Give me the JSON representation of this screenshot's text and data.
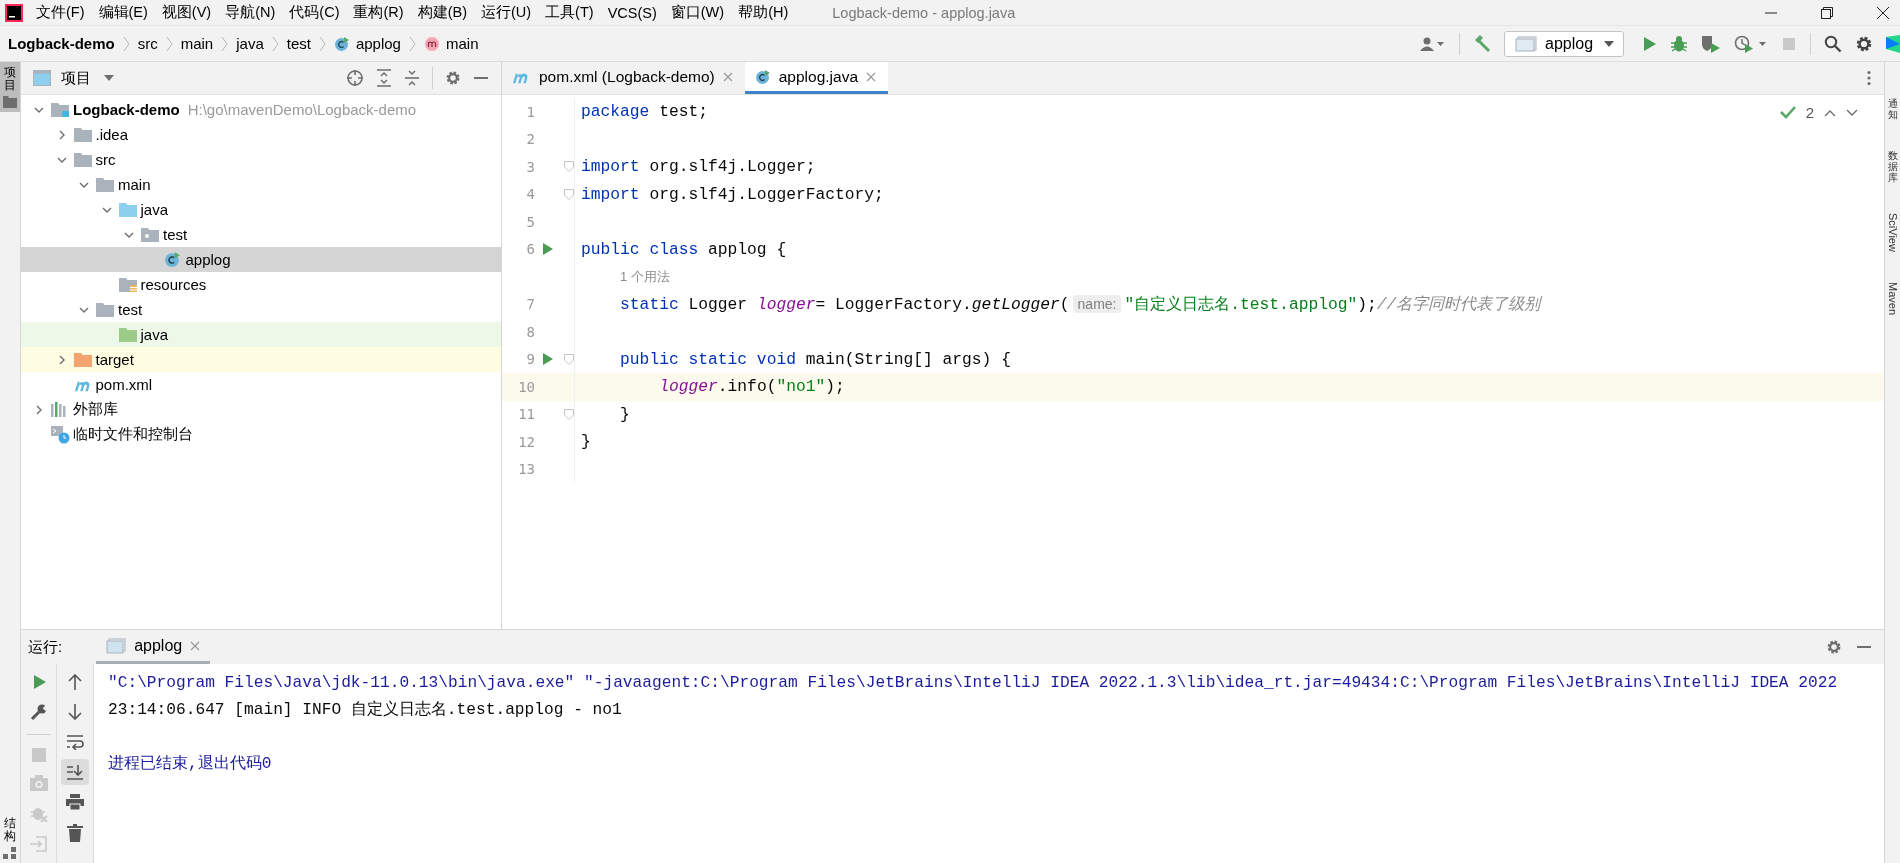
{
  "menu_bar": {
    "items": [
      "文件(F)",
      "编辑(E)",
      "视图(V)",
      "导航(N)",
      "代码(C)",
      "重构(R)",
      "构建(B)",
      "运行(U)",
      "工具(T)",
      "VCS(S)",
      "窗口(W)",
      "帮助(H)"
    ],
    "title": "Logback-demo - applog.java"
  },
  "breadcrumbs": [
    {
      "label": "Logback-demo",
      "kind": "project"
    },
    {
      "label": "src",
      "kind": "folder"
    },
    {
      "label": "main",
      "kind": "folder"
    },
    {
      "label": "java",
      "kind": "folder"
    },
    {
      "label": "test",
      "kind": "folder"
    },
    {
      "label": "applog",
      "kind": "class"
    },
    {
      "label": "main",
      "kind": "method"
    }
  ],
  "toolbar": {
    "run_config": "applog"
  },
  "left_strip": {
    "top": [
      {
        "label": "项目",
        "selected": true
      }
    ],
    "bottom": [
      {
        "label": "结构",
        "selected": false
      }
    ]
  },
  "project_panel": {
    "title": "项目",
    "tree": [
      {
        "label": "Logback-demo",
        "path": "H:\\go\\mavenDemo\\Logback-demo",
        "kind": "module",
        "expanded": true,
        "selected": false,
        "children": [
          {
            "label": ".idea",
            "kind": "folder",
            "expanded": false,
            "selected": false
          },
          {
            "label": "src",
            "kind": "folder",
            "expanded": true,
            "selected": false,
            "children": [
              {
                "label": "main",
                "kind": "folder",
                "expanded": true,
                "selected": false,
                "children": [
                  {
                    "label": "java",
                    "kind": "source-folder",
                    "expanded": true,
                    "selected": false,
                    "children": [
                      {
                        "label": "test",
                        "kind": "package",
                        "expanded": true,
                        "selected": false,
                        "children": [
                          {
                            "label": "applog",
                            "kind": "class",
                            "selected": true
                          }
                        ]
                      }
                    ]
                  },
                  {
                    "label": "resources",
                    "kind": "resources",
                    "selected": false
                  }
                ]
              },
              {
                "label": "test",
                "kind": "folder",
                "expanded": true,
                "selected": false,
                "children": [
                  {
                    "label": "java",
                    "kind": "test-source-folder",
                    "selected": false
                  }
                ]
              }
            ]
          },
          {
            "label": "target",
            "kind": "excluded-folder",
            "expanded": false,
            "selected": false
          },
          {
            "label": "pom.xml",
            "kind": "maven-file",
            "selected": false
          }
        ]
      },
      {
        "label": "外部库",
        "kind": "libraries",
        "expanded": false,
        "selected": false
      },
      {
        "label": "临时文件和控制台",
        "kind": "scratches",
        "selected": false
      }
    ]
  },
  "editor_tabs": [
    {
      "label": "pom.xml (Logback-demo)",
      "kind": "maven-file",
      "selected": false
    },
    {
      "label": "applog.java",
      "kind": "class",
      "selected": true
    }
  ],
  "editor": {
    "inspection_count": "2",
    "lines": [
      {
        "number": "1",
        "tokens": [
          {
            "text": "package",
            "kind": "keyword"
          },
          {
            "text": " test;",
            "kind": "plain"
          }
        ]
      },
      {
        "number": "2"
      },
      {
        "number": "3",
        "fold": true,
        "tokens": [
          {
            "text": "import",
            "kind": "keyword"
          },
          {
            "text": " org.slf4j.Logger;",
            "kind": "plain"
          }
        ]
      },
      {
        "number": "4",
        "fold": true,
        "tokens": [
          {
            "text": "import",
            "kind": "keyword"
          },
          {
            "text": " org.slf4j.LoggerFactory;",
            "kind": "plain"
          }
        ]
      },
      {
        "number": "5"
      },
      {
        "number": "6",
        "run": true,
        "tokens": [
          {
            "text": "public class",
            "kind": "keyword"
          },
          {
            "text": " applog {",
            "kind": "plain"
          }
        ]
      },
      {
        "number": "7",
        "hint": "1 个用法",
        "tokens": [
          {
            "text": "    static",
            "kind": "keyword"
          },
          {
            "text": " Logger ",
            "kind": "plain"
          },
          {
            "text": "logger",
            "kind": "field"
          },
          {
            "text": "= LoggerFactory.",
            "kind": "plain"
          },
          {
            "text": "getLogger",
            "kind": "static-method"
          },
          {
            "text": "(",
            "kind": "plain"
          },
          {
            "text": "name:",
            "kind": "parameter-hint"
          },
          {
            "text": "\"自定义日志名.test.applog\"",
            "kind": "string"
          },
          {
            "text": ");",
            "kind": "plain"
          },
          {
            "text": "//名字同时代表了级别",
            "kind": "comment"
          }
        ]
      },
      {
        "number": "8"
      },
      {
        "number": "9",
        "run": true,
        "fold": true,
        "tokens": [
          {
            "text": "    public static void",
            "kind": "keyword"
          },
          {
            "text": " main(String[] args) {",
            "kind": "plain"
          }
        ]
      },
      {
        "number": "10",
        "current": true,
        "tokens": [
          {
            "text": "        logger",
            "kind": "field"
          },
          {
            "text": ".info(",
            "kind": "plain"
          },
          {
            "text": "\"no1\"",
            "kind": "string"
          },
          {
            "text": ");",
            "kind": "plain"
          }
        ]
      },
      {
        "number": "11",
        "fold": true,
        "tokens": [
          {
            "text": "    }",
            "kind": "plain"
          }
        ]
      },
      {
        "number": "12",
        "tokens": [
          {
            "text": "}",
            "kind": "plain"
          }
        ]
      },
      {
        "number": "13"
      }
    ]
  },
  "right_strip": [
    {
      "label": "通知",
      "kind": "cjk"
    },
    {
      "label": "数据库",
      "kind": "cjk"
    },
    {
      "label": "SciView",
      "kind": "latin"
    },
    {
      "label": "Maven",
      "kind": "latin"
    }
  ],
  "run_panel": {
    "label": "运行:",
    "tabs": [
      {
        "label": "applog",
        "selected": true
      }
    ],
    "console": [
      {
        "text": "\"C:\\Program Files\\Java\\jdk-11.0.13\\bin\\java.exe\" \"-javaagent:C:\\Program Files\\JetBrains\\IntelliJ IDEA 2022.1.3\\lib\\idea_rt.jar=49434:C:\\Program Files\\JetBrains\\IntelliJ IDEA 2022",
        "kind": "command"
      },
      {
        "text": "23:14:06.647 [main] INFO 自定义日志名.test.applog - no1",
        "kind": "output"
      },
      {
        "text": "进程已结束,退出代码0",
        "kind": "exit"
      }
    ]
  }
}
